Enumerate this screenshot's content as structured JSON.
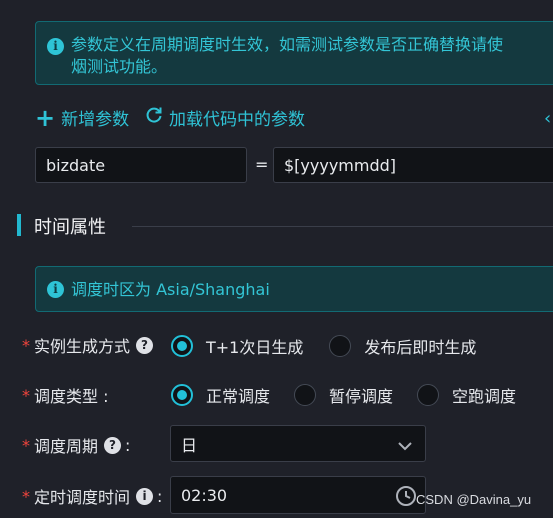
{
  "notice_top": {
    "line1": "参数定义在周期调度时生效，如需测试参数是否正确替换请使",
    "line2": "烟测试功能。"
  },
  "param_actions": {
    "add_label": "新增参数",
    "load_label": "加载代码中的参数"
  },
  "param_row": {
    "name": "bizdate",
    "equals": "=",
    "value": "$[yyyymmdd]"
  },
  "section": {
    "title": "时间属性"
  },
  "timezone_notice": {
    "text": "调度时区为 Asia/Shanghai"
  },
  "instance_mode": {
    "label": "实例生成方式",
    "options": [
      "T+1次日生成",
      "发布后即时生成"
    ],
    "selected": "T+1次日生成"
  },
  "schedule_type": {
    "label": "调度类型 :",
    "options": [
      "正常调度",
      "暂停调度",
      "空跑调度"
    ],
    "selected": "正常调度"
  },
  "schedule_cycle": {
    "label": "调度周期",
    "colon": ":",
    "value": "日"
  },
  "schedule_time": {
    "label": "定时调度时间",
    "colon": ":",
    "value": "02:30"
  },
  "watermark": "CSDN @Davina_yu",
  "colors": {
    "accent": "#22c0d8",
    "background": "#1f2129",
    "required": "#f2453d"
  }
}
